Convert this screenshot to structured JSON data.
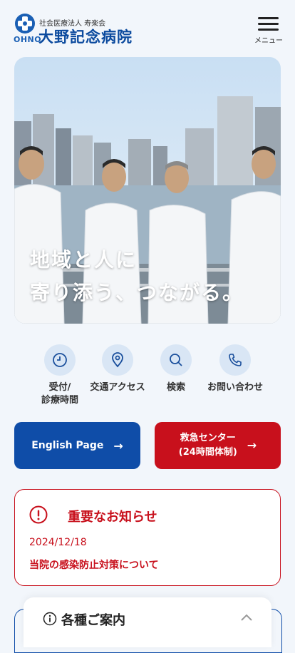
{
  "header": {
    "logo_sub": "社会医療法人 寿楽会",
    "logo_title": "大野記念病院",
    "logo_en": "OHNO",
    "menu_label": "メニュー"
  },
  "hero": {
    "line1": "地域と人に",
    "line2": "寄り添う、つながる。"
  },
  "quick_links": [
    {
      "label": "受付/\n診療時間",
      "icon": "clock-icon"
    },
    {
      "label": "交通アクセス",
      "icon": "map-pin-icon"
    },
    {
      "label": "検索",
      "icon": "search-icon"
    },
    {
      "label": "お問い合わせ",
      "icon": "phone-icon"
    }
  ],
  "buttons": {
    "english": "English Page",
    "emergency_line1": "救急センター",
    "emergency_line2": "(24時間体制)"
  },
  "notice": {
    "title": "重要なお知らせ",
    "date": "2024/12/18",
    "link": "当院の感染防止対策について"
  },
  "panel": {
    "title": "各種ご案内"
  },
  "colors": {
    "brand_blue": "#0f4da8",
    "emergency_red": "#c8101c",
    "background": "#f2f6fb"
  }
}
